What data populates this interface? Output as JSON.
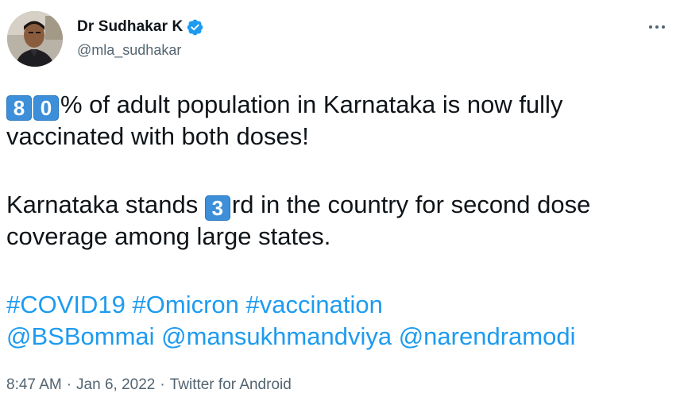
{
  "author": {
    "display_name": "Dr Sudhakar K",
    "handle": "@mla_sudhakar",
    "verified": true,
    "verified_color": "#1d9bf0"
  },
  "tweet": {
    "line1_keycaps": [
      "8",
      "0"
    ],
    "line1_text": "% of adult population in Karnataka is now fully",
    "line2_text": "vaccinated with both doses!",
    "line3_pre": "Karnataka stands ",
    "line3_keycap": "3",
    "line3_post": "rd in the country for second dose",
    "line4_text": "coverage among large states.",
    "hashtags": [
      "#COVID19",
      "#Omicron",
      "#vaccination"
    ],
    "mentions": [
      "@BSBommai",
      "@mansukhmandviya",
      "@narendramodi"
    ]
  },
  "meta": {
    "time": "8:47 AM",
    "separator": "·",
    "date": "Jan 6, 2022",
    "source": "Twitter for Android"
  },
  "colors": {
    "link": "#1d9bf0",
    "text": "#0f1419",
    "secondary": "#536471",
    "keycap": "#3d8fd9"
  },
  "icons": {
    "more": "more-horizontal-icon",
    "verified": "verified-badge-icon"
  }
}
